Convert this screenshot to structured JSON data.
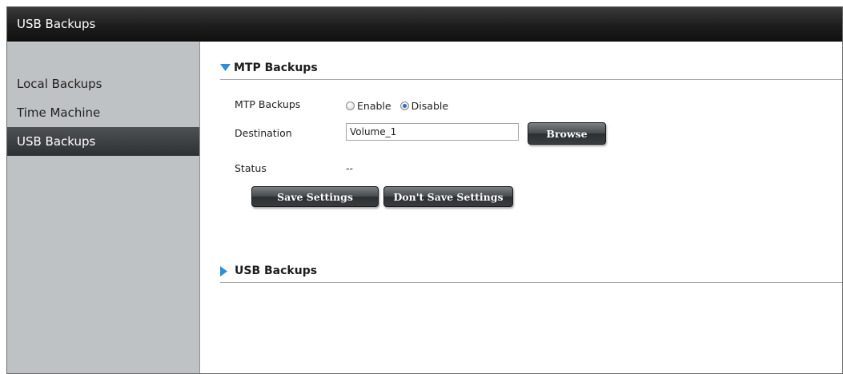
{
  "window": {
    "title": "USB Backups"
  },
  "sidebar": {
    "items": [
      {
        "label": "Local Backups",
        "active": false
      },
      {
        "label": "Time Machine",
        "active": false
      },
      {
        "label": "USB Backups",
        "active": true
      }
    ]
  },
  "mtp": {
    "header": "MTP Backups",
    "expanded": true,
    "backups_label": "MTP Backups",
    "enable_label": "Enable",
    "disable_label": "Disable",
    "selected": "Disable",
    "destination_label": "Destination",
    "destination_value": "Volume_1",
    "browse_label": "Browse",
    "status_label": "Status",
    "status_value": "--",
    "save_label": "Save Settings",
    "dont_save_label": "Don't Save Settings"
  },
  "usb": {
    "header": "USB Backups",
    "expanded": false
  },
  "colors": {
    "accent_triangle": "#2e8fd8",
    "sidebar_bg": "#bfc2c4",
    "active_item_bg": "#3c4042"
  }
}
